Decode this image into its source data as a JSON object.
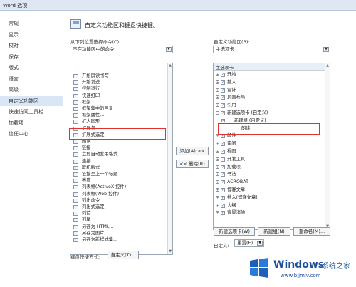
{
  "title": "Word 选项",
  "sidebar": {
    "items": [
      "常规",
      "显示",
      "校对",
      "保存",
      "版式",
      "语言",
      "高级",
      "自定义功能区",
      "快速访问工具栏",
      "加载项",
      "信任中心"
    ],
    "active_index": 7
  },
  "main": {
    "heading": "自定义功能区和键盘快捷键。",
    "left_label": "从下列位置选择命令(C):",
    "left_select": "不在功能区中的命令",
    "right_label": "自定义功能区(B):",
    "right_select": "主选项卡",
    "commands": [
      "开始屏读书写",
      "开始发送",
      "控制运行",
      "快速打印",
      "框架",
      "框架集中的目录",
      "框架属性...",
      "扩大图形",
      "扩展包",
      "扩展式选定",
      "朗读",
      "链接",
      "立即自动套用格式",
      "连接",
      "联机版式",
      "链接至上一个标题",
      "亮度",
      "列表框(ActiveX 控件)",
      "列表框(Web 控件)",
      "列出命令",
      "列出式选定",
      "列首",
      "列尾",
      "另存为 HTML...",
      "另存为图片...",
      "另存为新样式集..."
    ],
    "add_button": "添加(A) >>",
    "remove_button": "<< 删除(R)",
    "tree_header": "主选项卡",
    "tree": [
      "开始",
      "插入",
      "设计",
      "页面布局",
      "引用",
      "新建选项卡 (自定义)",
      "新建组 (自定义)",
      "朗读",
      "邮件",
      "审阅",
      "视图",
      "开发工具",
      "加载项",
      "书法",
      "ACROBAT",
      "博客文章",
      "插入(博客文章)",
      "大纲",
      "背景消除"
    ],
    "new_tab_button": "新建选项卡(W)",
    "new_group_button": "新建组(N)",
    "rename_button": "重命名(M)...",
    "customize_label": "自定义:",
    "reset_label": "重置(E)",
    "shortcuts_label": "键盘快捷方式:",
    "shortcuts_button": "自定义(T)..."
  },
  "watermark": {
    "brand": "Windows",
    "cn": "系统之家",
    "url": "www.bjjmlv.com"
  },
  "colors": {
    "highlight": "#e03030",
    "sidebar_active": "#d8e6f5",
    "brand": "#1d4f9b"
  }
}
